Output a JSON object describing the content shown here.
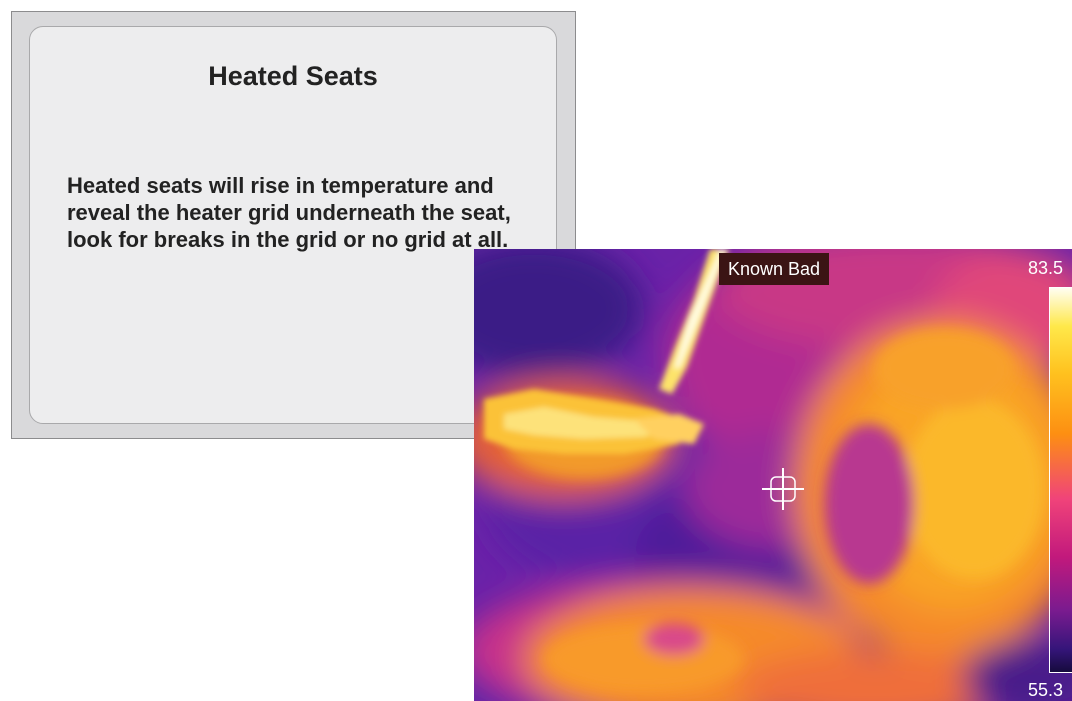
{
  "card": {
    "title": "Heated Seats",
    "body": "Heated seats will rise in temperature and reveal the heater grid underneath the seat, look for breaks in the grid or no grid at all."
  },
  "thermal": {
    "label": "Known Bad",
    "scale_max": "83.5",
    "scale_min": "55.3",
    "palette": [
      "#160b3d",
      "#35157a",
      "#7a1b8f",
      "#c2197c",
      "#f0437a",
      "#fd8f12",
      "#ffc21f",
      "#ffe84a",
      "#fffef2"
    ]
  }
}
